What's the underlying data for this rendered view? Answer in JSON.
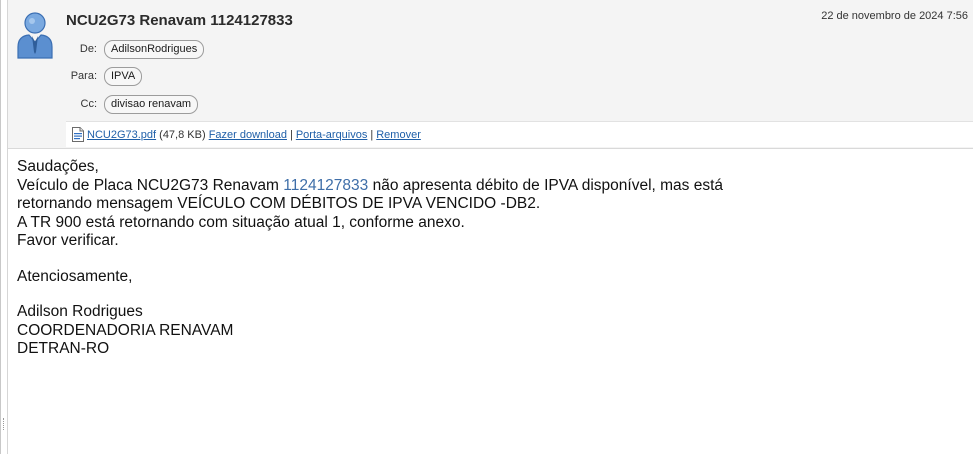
{
  "message": {
    "subject": "NCU2G73 Renavam 1124127833",
    "datetime": "22 de novembro de 2024 7:56",
    "from_label": "De:",
    "from": "AdilsonRodrigues",
    "to_label": "Para:",
    "to": "IPVA",
    "cc_label": "Cc:",
    "cc": "divisao renavam"
  },
  "attachment": {
    "icon": "pdf-file-icon",
    "filename": "NCU2G73.pdf",
    "size": "(47,8 KB)",
    "download_label": "Fazer download",
    "portfolio_label": "Porta-arquivos",
    "remove_label": "Remover",
    "separator": "|"
  },
  "body": {
    "greeting": "Saudações,",
    "line1_before": "Veículo de Placa NCU2G73 Renavam ",
    "line1_number": "1124127833",
    "line1_after": " não apresenta débito de IPVA disponível, mas está",
    "line2": "retornando mensagem VEÍCULO COM DÉBITOS DE IPVA VENCIDO -DB2.",
    "line3": "A TR 900 está retornando com situação atual 1, conforme anexo.",
    "line4": "Favor verificar.",
    "closing": "Atenciosamente,",
    "sig_name": "Adilson Rodrigues",
    "sig_dept": "COORDENADORIA RENAVAM",
    "sig_org": "DETRAN-RO"
  },
  "colors": {
    "header_bg": "#f4f4f4",
    "link": "#1f5fa8",
    "avatar": "#5b8fd0"
  }
}
